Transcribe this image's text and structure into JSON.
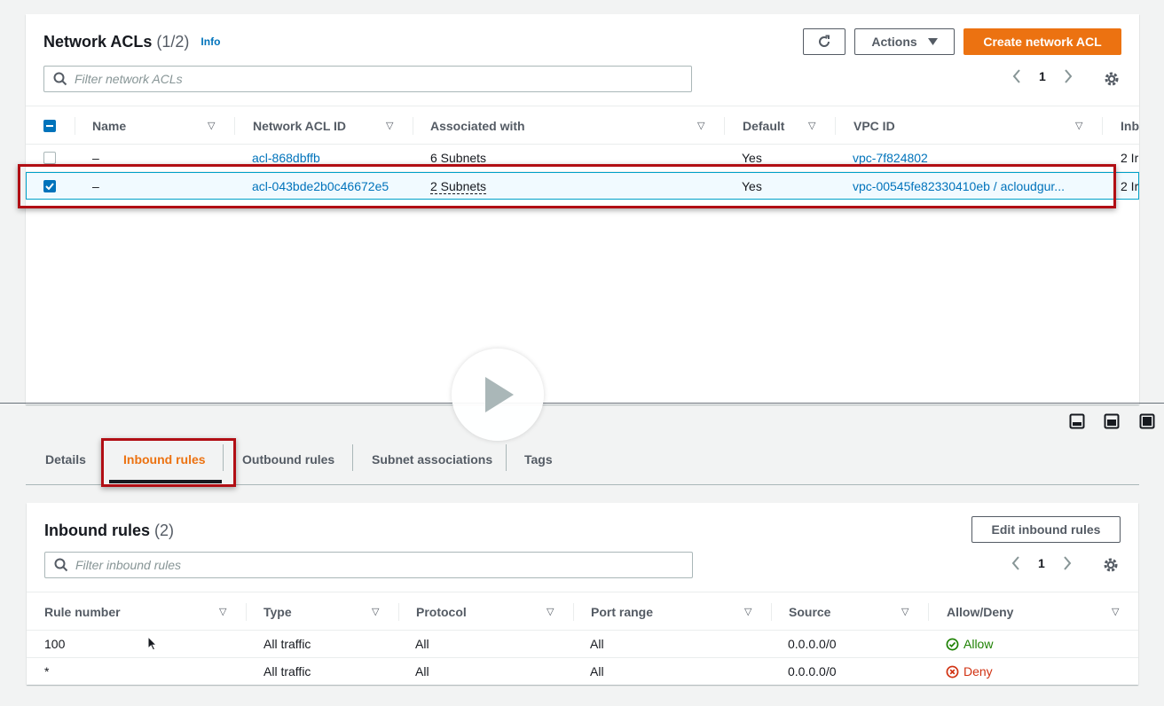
{
  "top": {
    "title": "Network ACLs",
    "count": "(1/2)",
    "info": "Info",
    "actions_label": "Actions",
    "create_label": "Create network ACL",
    "filter_placeholder": "Filter network ACLs",
    "page": "1",
    "columns": [
      "Name",
      "Network ACL ID",
      "Associated with",
      "Default",
      "VPC ID",
      "Inb"
    ],
    "rows": [
      {
        "name": "–",
        "acl_id": "acl-868dbffb",
        "associated": "6 Subnets",
        "default": "Yes",
        "vpc": "vpc-7f824802",
        "inbound": "2 Ir",
        "selected": false
      },
      {
        "name": "–",
        "acl_id": "acl-043bde2b0c46672e5",
        "associated": "2 Subnets",
        "default": "Yes",
        "vpc": "vpc-00545fe82330410eb / acloudgur...",
        "inbound": "2 Ir",
        "selected": true
      }
    ]
  },
  "tabs": [
    "Details",
    "Inbound rules",
    "Outbound rules",
    "Subnet associations",
    "Tags"
  ],
  "active_tab": "Inbound rules",
  "inbound": {
    "title": "Inbound rules",
    "count": "(2)",
    "edit_label": "Edit inbound rules",
    "filter_placeholder": "Filter inbound rules",
    "page": "1",
    "columns": [
      "Rule number",
      "Type",
      "Protocol",
      "Port range",
      "Source",
      "Allow/Deny"
    ],
    "rows": [
      {
        "rule": "100",
        "type": "All traffic",
        "protocol": "All",
        "port": "All",
        "source": "0.0.0.0/0",
        "action": "Allow"
      },
      {
        "rule": "*",
        "type": "All traffic",
        "protocol": "All",
        "port": "All",
        "source": "0.0.0.0/0",
        "action": "Deny"
      }
    ]
  },
  "colors": {
    "accent": "#ec7211",
    "link": "#0073bb",
    "allow": "#1d8102",
    "deny": "#d13212",
    "highlight": "#b10e14"
  },
  "icons": [
    "refresh-icon",
    "caret-down-icon",
    "search-icon",
    "chevron-left-icon",
    "chevron-right-icon",
    "gear-icon",
    "sort-icon",
    "allow-icon",
    "deny-icon",
    "play-icon"
  ]
}
